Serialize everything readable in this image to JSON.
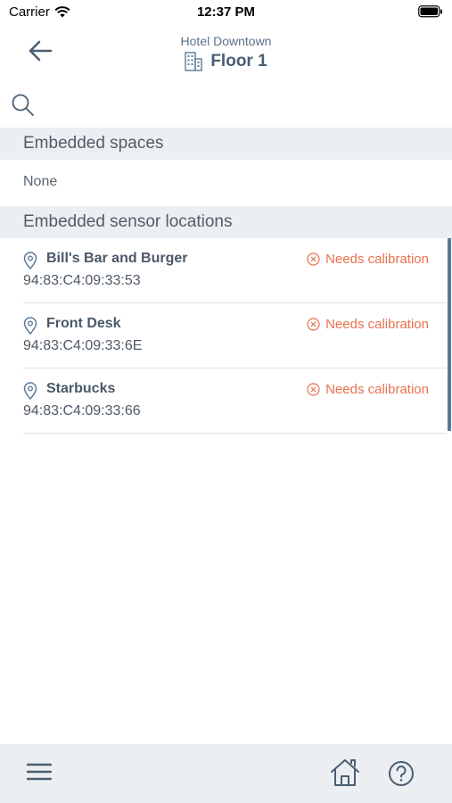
{
  "status_bar": {
    "carrier": "Carrier",
    "time": "12:37 PM"
  },
  "header": {
    "subtitle": "Hotel Downtown",
    "title": "Floor 1"
  },
  "sections": {
    "embedded_spaces": {
      "label": "Embedded spaces",
      "empty_text": "None"
    },
    "embedded_sensors": {
      "label": "Embedded sensor locations",
      "items": [
        {
          "name": "Bill's Bar and Burger",
          "mac": "94:83:C4:09:33:53",
          "status": "Needs calibration"
        },
        {
          "name": "Front Desk",
          "mac": "94:83:C4:09:33:6E",
          "status": "Needs calibration"
        },
        {
          "name": "Starbucks",
          "mac": "94:83:C4:09:33:66",
          "status": "Needs calibration"
        }
      ]
    }
  },
  "colors": {
    "accent": "#5a7a9a",
    "warning": "#e8704e",
    "section_bg": "#eceff1"
  },
  "icons": {
    "back": "arrow-left-icon",
    "building": "building-icon",
    "search": "search-icon",
    "pin": "location-pin-icon",
    "status": "circle-x-icon",
    "menu": "hamburger-menu-icon",
    "home": "home-icon",
    "help": "help-icon"
  }
}
